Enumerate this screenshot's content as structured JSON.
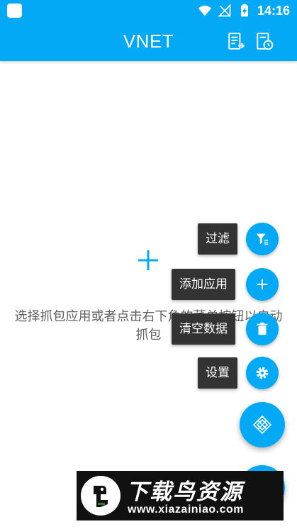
{
  "status_bar": {
    "time": "14:16"
  },
  "app_bar": {
    "title": "VNET"
  },
  "empty_state": {
    "message": "选择抓包应用或者点击右下角的菜单按钮以启动抓包"
  },
  "speed_dial": {
    "items": [
      {
        "label": "过滤",
        "icon": "filter-icon"
      },
      {
        "label": "添加应用",
        "icon": "plus-icon"
      },
      {
        "label": "清空数据",
        "icon": "trash-icon"
      },
      {
        "label": "设置",
        "icon": "gear-icon"
      }
    ],
    "main_icon": "diamond-icon"
  },
  "watermark": {
    "title": "下载鸟资源",
    "url": "www.xiazainiao.com"
  },
  "colors": {
    "primary": "#03a9f4",
    "label_bg": "#333333",
    "text_gray": "#616161"
  }
}
